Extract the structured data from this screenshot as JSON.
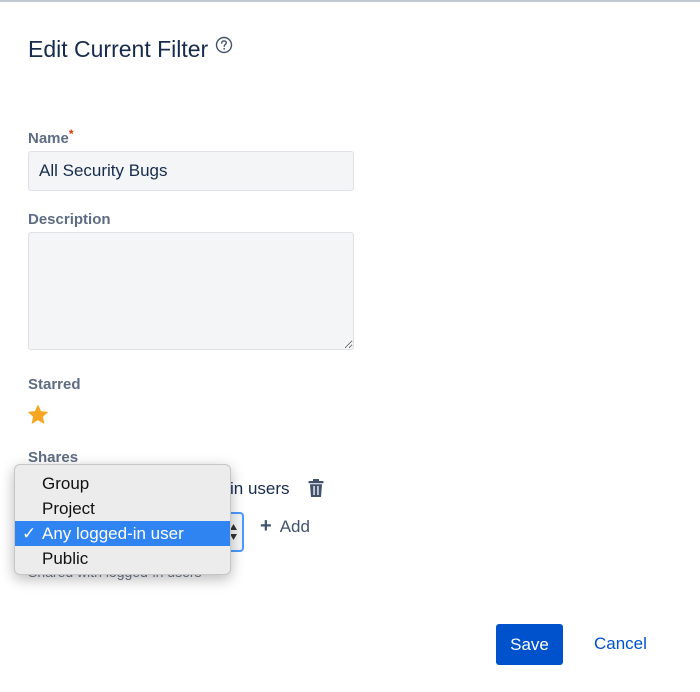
{
  "dialog": {
    "title": "Edit Current Filter",
    "help_icon": "question-circle-icon"
  },
  "name_field": {
    "label": "Name",
    "required_mark": "*",
    "value": "All Security Bugs"
  },
  "description_field": {
    "label": "Description",
    "value": ""
  },
  "starred": {
    "label": "Starred",
    "icon": "star-icon",
    "color": "#f6a623"
  },
  "shares": {
    "label": "Shares",
    "existing_share": "in users",
    "remove_icon": "trash-icon",
    "add_label": "Add",
    "note": "Shared with logged-in users"
  },
  "share_dropdown": {
    "options": [
      "Group",
      "Project",
      "Any logged-in user",
      "Public"
    ],
    "selected": "Any logged-in user",
    "check_mark": "✓"
  },
  "actions": {
    "save_label": "Save",
    "cancel_label": "Cancel"
  },
  "colors": {
    "primary": "#0052cc",
    "highlight": "#2f84f1",
    "focus": "#4c9aff",
    "required": "#de350b"
  }
}
